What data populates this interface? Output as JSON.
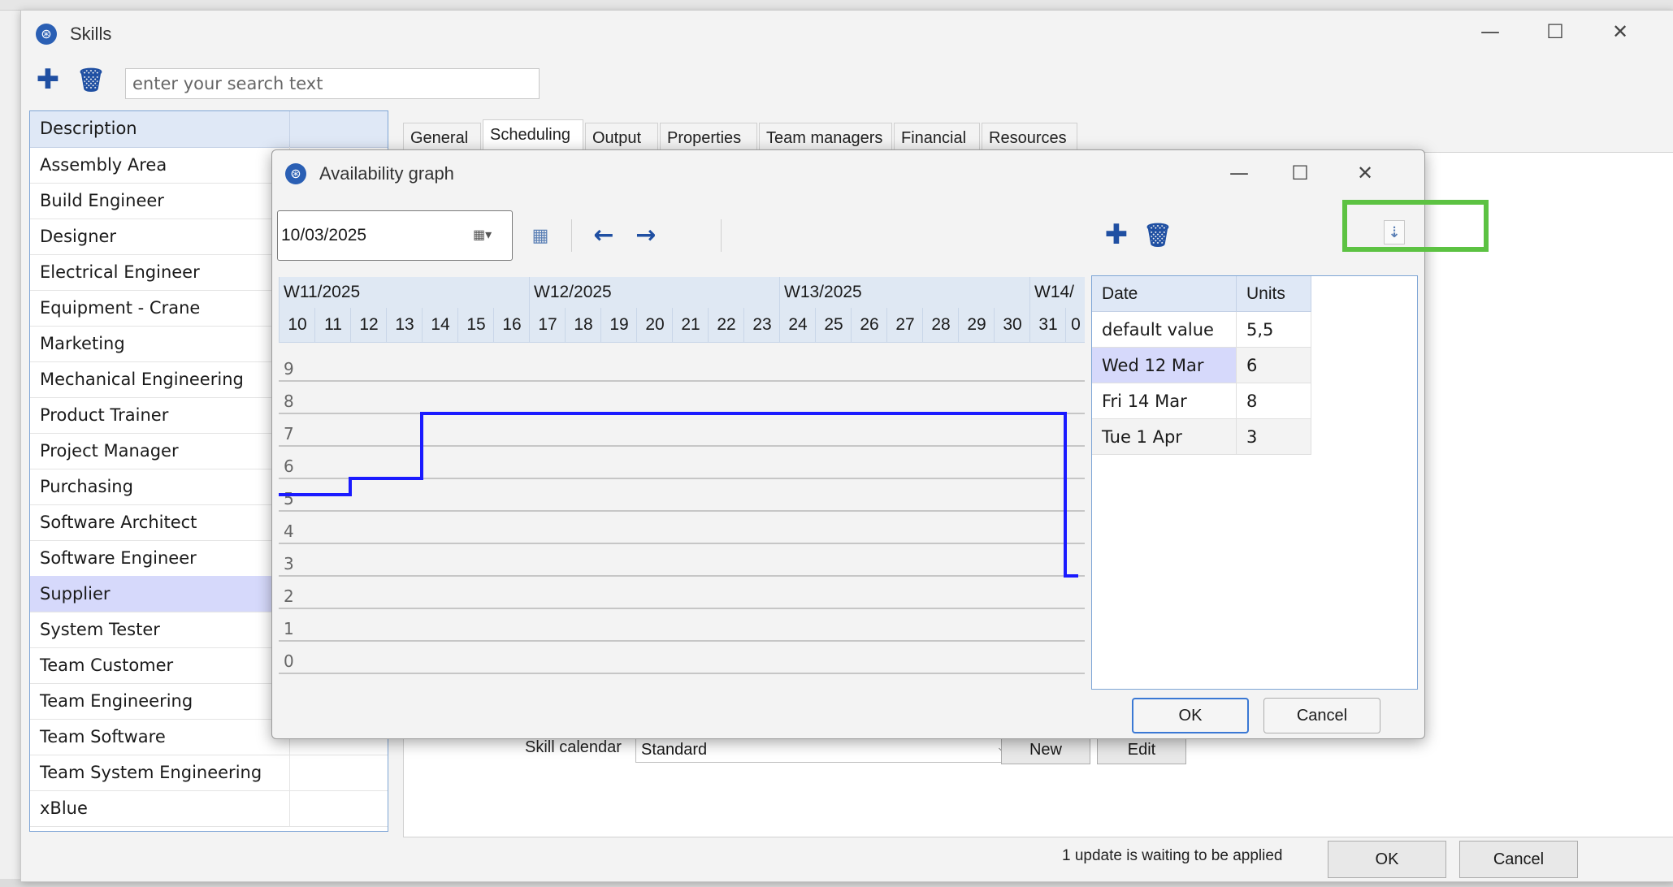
{
  "skills_window": {
    "title": "Skills",
    "search_placeholder": "enter your search text",
    "list_header": "Description",
    "skills": [
      "Assembly Area",
      "Build Engineer",
      "Designer",
      "Electrical Engineer",
      "Equipment - Crane",
      "Marketing",
      "Mechanical Engineering",
      "Product Trainer",
      "Project Manager",
      "Purchasing",
      "Software Architect",
      "Software Engineer",
      "Supplier",
      "System Tester",
      "Team Customer",
      "Team Engineering",
      "Team Software",
      "Team System Engineering",
      "xBlue"
    ],
    "selected_skill": "Supplier",
    "tabs": [
      "General",
      "Scheduling",
      "Output",
      "Properties",
      "Team managers",
      "Financial",
      "Resources"
    ],
    "active_tab": "Scheduling",
    "skill_calendar_label": "Skill calendar",
    "skill_calendar_value": "Standard",
    "new_label": "New",
    "edit_label": "Edit",
    "status": "1 update is waiting to be applied",
    "ok_label": "OK",
    "cancel_label": "Cancel"
  },
  "availability_dialog": {
    "title": "Availability graph",
    "date_value": "10/03/2025",
    "weeks": [
      "W11/2025",
      "W12/2025",
      "W13/2025",
      "W14/"
    ],
    "days": [
      "10",
      "11",
      "12",
      "13",
      "14",
      "15",
      "16",
      "17",
      "18",
      "19",
      "20",
      "21",
      "22",
      "23",
      "24",
      "25",
      "26",
      "27",
      "28",
      "29",
      "30",
      "31",
      "0"
    ],
    "table_headers": {
      "date": "Date",
      "units": "Units"
    },
    "table_rows": [
      {
        "date": "default value",
        "units": "5,5"
      },
      {
        "date": "Wed 12 Mar",
        "units": "6"
      },
      {
        "date": "Fri 14 Mar",
        "units": "8"
      },
      {
        "date": "Tue 1 Apr",
        "units": "3"
      }
    ],
    "ok_label": "OK",
    "cancel_label": "Cancel"
  },
  "chart_data": {
    "type": "line",
    "y_ticks": [
      "9",
      "8",
      "7",
      "6",
      "5",
      "4",
      "3",
      "2",
      "1",
      "0"
    ],
    "ylim": [
      0,
      10
    ],
    "x_days": [
      "10",
      "11",
      "12",
      "13",
      "14",
      "15",
      "16",
      "17",
      "18",
      "19",
      "20",
      "21",
      "22",
      "23",
      "24",
      "25",
      "26",
      "27",
      "28",
      "29",
      "30",
      "31"
    ],
    "series": [
      {
        "values": [
          5.5,
          5.5,
          6,
          6,
          8,
          8,
          8,
          8,
          8,
          8,
          8,
          8,
          8,
          8,
          8,
          8,
          8,
          8,
          8,
          8,
          8,
          8,
          3
        ],
        "color": "#1a1aff"
      }
    ],
    "grid": true
  },
  "colors": {
    "accent": "#1f4fa2",
    "selection": "#d6d9fb",
    "highlight": "#5cc242",
    "line": "#1a1aff"
  },
  "icons": [
    "app-logo-icon",
    "add-icon",
    "delete-icon",
    "calendar-icon",
    "arrow-left-icon",
    "arrow-right-icon",
    "export-icon"
  ]
}
